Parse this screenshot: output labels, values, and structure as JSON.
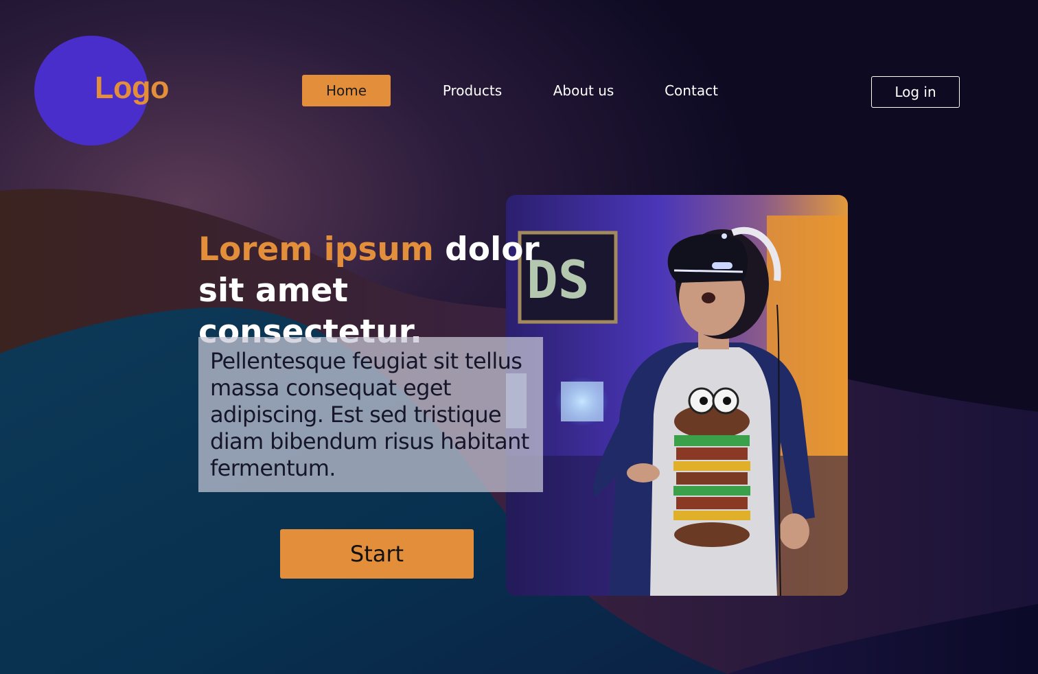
{
  "brand": {
    "logo_text": "Logo"
  },
  "nav": {
    "items": [
      {
        "label": "Home",
        "active": true
      },
      {
        "label": "Products",
        "active": false
      },
      {
        "label": "About us",
        "active": false
      },
      {
        "label": "Contact",
        "active": false
      }
    ],
    "login_label": "Log in"
  },
  "hero": {
    "headline_accent": "Lorem ipsum",
    "headline_rest": " dolor sit amet consectetur.",
    "description": "Pellentesque feugiat sit tellus massa consequat eget adipiscing. Est sed tristique diam bibendum risus habitant fermentum.",
    "cta_label": "Start",
    "image_subject": "person-wearing-vr-headset"
  },
  "colors": {
    "accent": "#e38e3a",
    "logo_circle": "#4a2ecb",
    "background_dark": "#0d0a22",
    "wave_teal": "#0f3a58",
    "text_light": "#ffffff"
  }
}
